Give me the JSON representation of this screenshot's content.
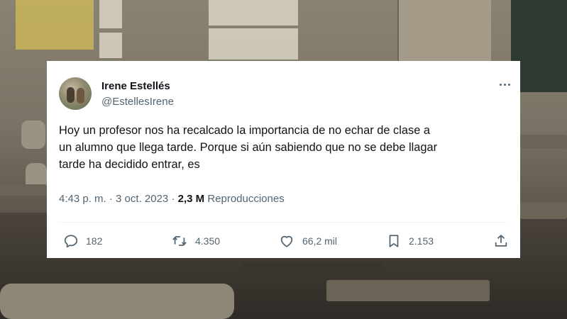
{
  "tweet": {
    "author_name": "Irene Estellés",
    "handle": "@EstellesIrene",
    "text_lines": [
      "Hoy un profesor nos ha recalcado la importancia de no echar de clase a",
      "un alumno que llega tarde. Porque si aún sabiendo que no se debe llagar",
      "tarde ha decidido entrar, es"
    ],
    "time": "4:43 p. m.",
    "separator": "·",
    "date": "3 oct. 2023",
    "views_count": "2,3 M",
    "views_label": "Reproducciones",
    "replies": "182",
    "reposts": "4.350",
    "likes": "66,2 mil",
    "bookmarks": "2.153"
  },
  "icons": {
    "more": "more-dots-icon",
    "reply": "reply-bubble-icon",
    "repost": "repost-arrows-icon",
    "like": "heart-icon",
    "bookmark": "bookmark-icon",
    "share": "share-upload-icon"
  },
  "colors": {
    "text_primary": "#0f1419",
    "text_secondary": "#536471",
    "card_background": "#ffffff"
  }
}
